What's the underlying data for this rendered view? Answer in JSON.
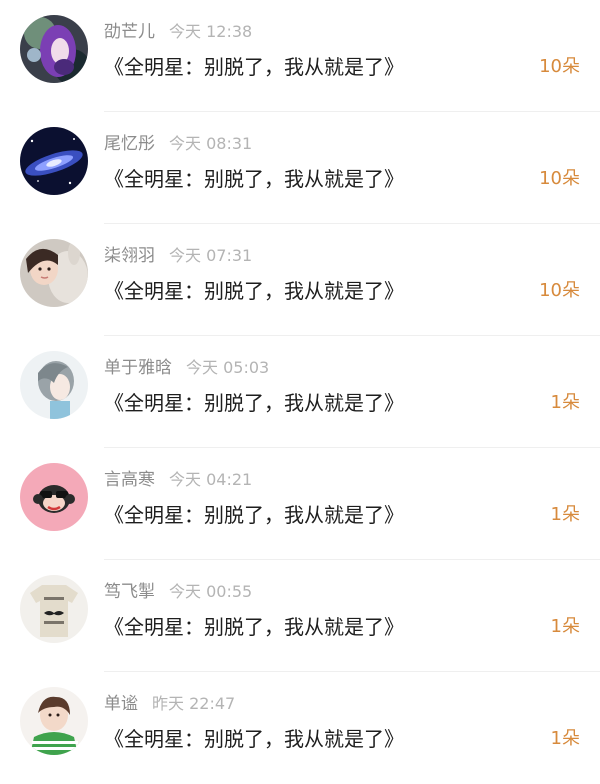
{
  "items": [
    {
      "name": "劭芒儿",
      "time": "今天 12:38",
      "title": "《全明星：别脱了，我从就是了》",
      "count": "10朵",
      "avatar": "purple-hair-girl-avatar"
    },
    {
      "name": "尾忆彤",
      "time": "今天 08:31",
      "title": "《全明星：别脱了，我从就是了》",
      "count": "10朵",
      "avatar": "galaxy-avatar"
    },
    {
      "name": "柒翎羽",
      "time": "今天 07:31",
      "title": "《全明星：别脱了，我从就是了》",
      "count": "10朵",
      "avatar": "girl-with-plush-avatar"
    },
    {
      "name": "单于雅晗",
      "time": "今天 05:03",
      "title": "《全明星：别脱了，我从就是了》",
      "count": "1朵",
      "avatar": "sketch-girl-avatar"
    },
    {
      "name": "言高寒",
      "time": "今天 04:21",
      "title": "《全明星：别脱了，我从就是了》",
      "count": "1朵",
      "avatar": "monkey-sunglasses-avatar"
    },
    {
      "name": "笃飞掣",
      "time": "今天 00:55",
      "title": "《全明星：别脱了，我从就是了》",
      "count": "1朵",
      "avatar": "bonjour-shirt-avatar"
    },
    {
      "name": "单谧",
      "time": "昨天 22:47",
      "title": "《全明星：别脱了，我从就是了》",
      "count": "1朵",
      "avatar": "girl-green-shirt-avatar"
    }
  ],
  "colors": {
    "name": "#8c8c8c",
    "time": "#b4b4b4",
    "title": "#1e1e1e",
    "count": "#d78a3c",
    "divider": "#efefef"
  }
}
